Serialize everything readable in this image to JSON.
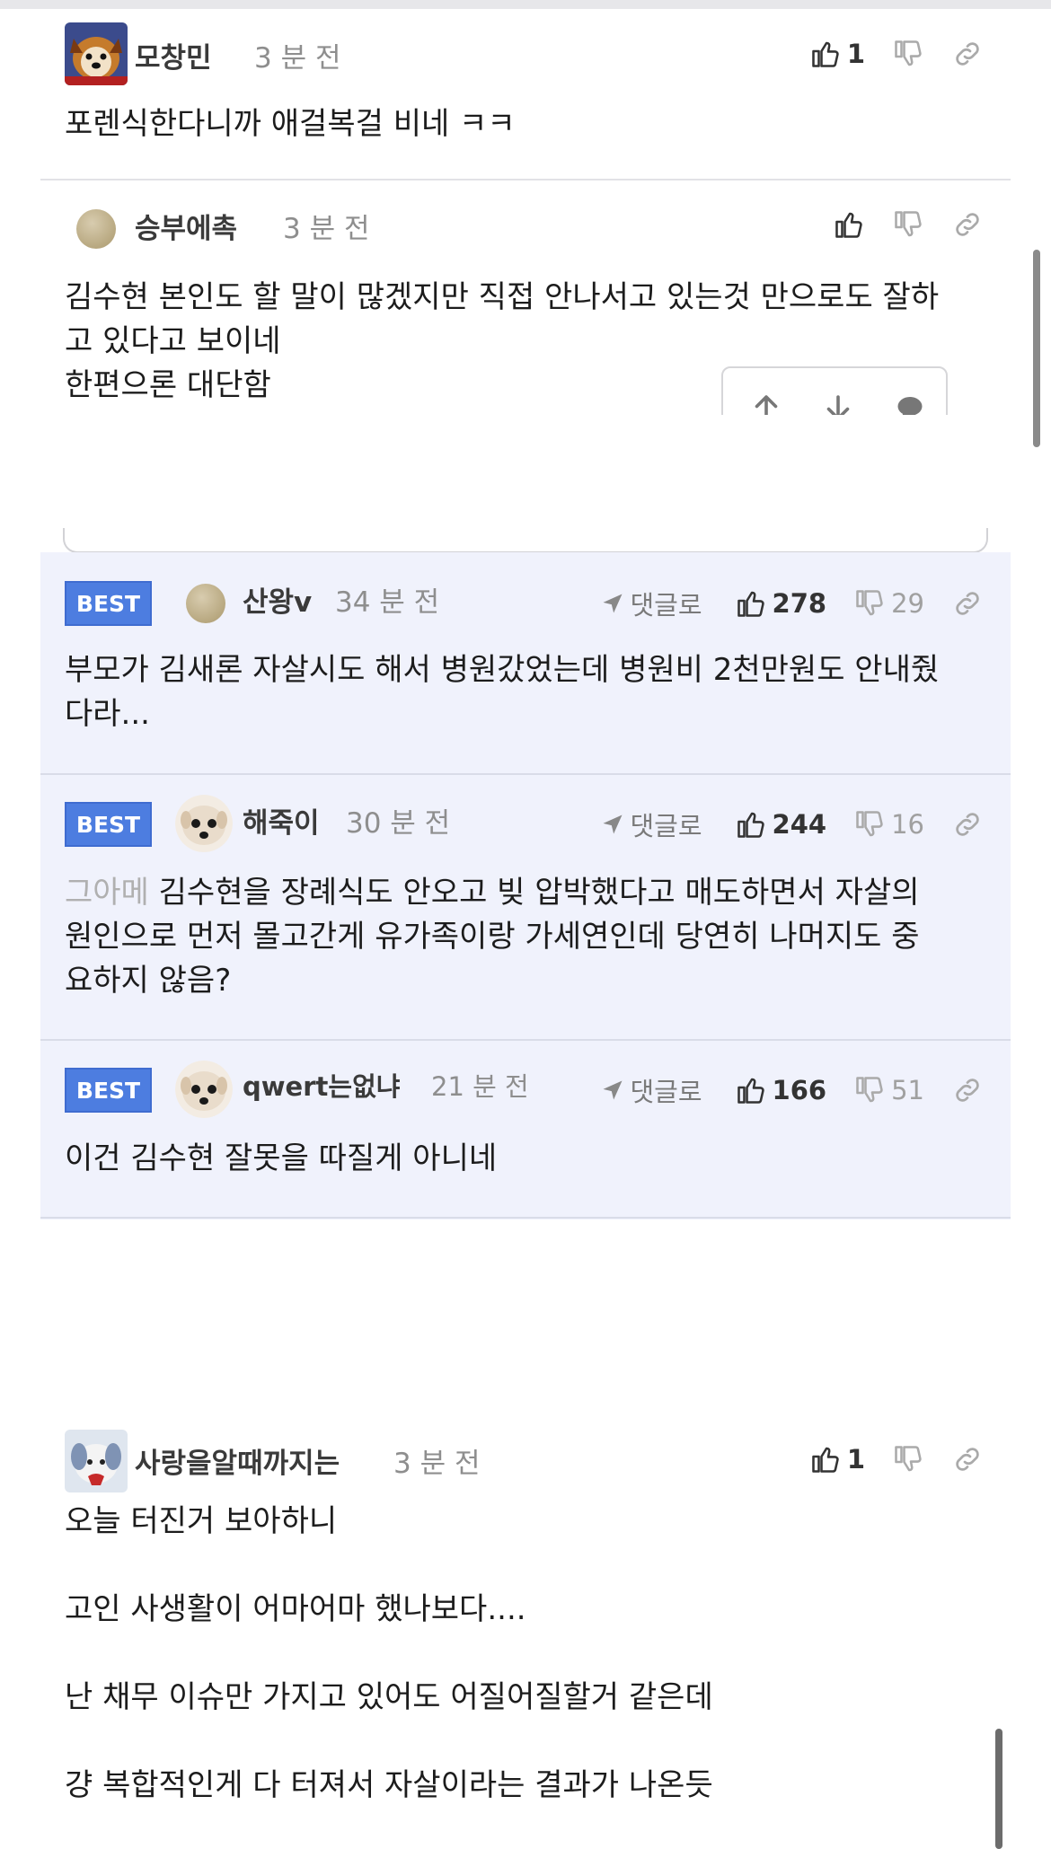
{
  "comments_top": [
    {
      "nick": "모창민",
      "time": "3 분 전",
      "body": "포렌식한다니까 애걸복걸 비네 ㅋㅋ",
      "likes": "1",
      "avatar": "puppy-face-avatar"
    },
    {
      "nick": "승부에촉",
      "time": "3 분 전",
      "body": "김수현 본인도 할 말이 많겠지만 직접 안나서고 있는것 만으로도 잘하\n고 있다고 보이네\n한편으론 대단함",
      "likes": "",
      "avatar": "beige-dot-avatar"
    }
  ],
  "best_comments": [
    {
      "badge": "BEST",
      "nick": "산왕v",
      "time": "34 분 전",
      "reply": "댓글로",
      "likes": "278",
      "dislikes": "29",
      "body": "부모가 김새론 자살시도 해서 병원갔었는데 병원비 2천만원도 안내줬\n다라..."
    },
    {
      "badge": "BEST",
      "nick": "해죽이",
      "time": "30 분 전",
      "reply": "댓글로",
      "likes": "244",
      "dislikes": "16",
      "quote": "그아메",
      "body": "김수현을 장례식도 안오고 빚 압박했다고 매도하면서 자살의\n원인으로 먼저 몰고간게 유가족이랑 가세연인데 당연히 나머지도 중\n요하지 않음?"
    },
    {
      "badge": "BEST",
      "nick": "qwert는없냐",
      "time": "21 분 전",
      "reply": "댓글로",
      "likes": "166",
      "dislikes": "51",
      "body": "이건 김수현 잘못을 따질게 아니네"
    }
  ],
  "comment_bottom": {
    "nick": "사랑을알때까지는",
    "time": "3 분 전",
    "likes": "1",
    "body": "오늘 터진거 보아하니\n\n고인 사생활이 어마어마 했나보다....\n\n난 채무 이슈만 가지고 있어도 어질어질할거 같은데\n\n걍 복합적인게 다 터져서 자살이라는 결과가 나온듯"
  },
  "icons": {
    "like": "thumbs-up-icon",
    "dislike": "thumbs-down-icon",
    "link": "link-icon",
    "reply": "send-arrow-icon",
    "float_up": "arrow-up-icon",
    "float_down": "arrow-down-icon",
    "float_comment": "speech-bubble-icon"
  },
  "colors": {
    "best_badge": "#4d7de0",
    "best_bg": "#f0f2fc",
    "muted_text": "#8e8e8e"
  }
}
